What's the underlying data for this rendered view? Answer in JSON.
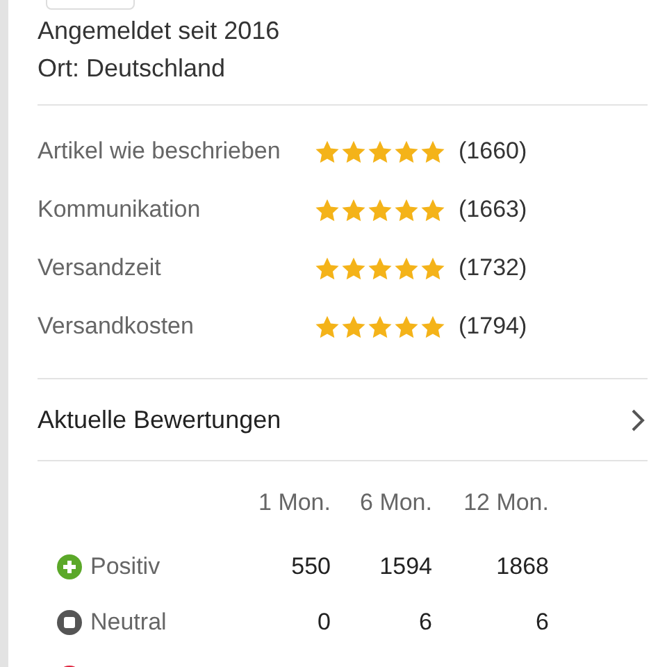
{
  "profile": {
    "member_since": "Angemeldet seit 2016",
    "location": "Ort: Deutschland"
  },
  "ratings": [
    {
      "label": "Artikel wie beschrieben",
      "stars": 5,
      "count": "(1660)"
    },
    {
      "label": "Kommunikation",
      "stars": 5,
      "count": "(1663)"
    },
    {
      "label": "Versandzeit",
      "stars": 5,
      "count": "(1732)"
    },
    {
      "label": "Versandkosten",
      "stars": 5,
      "count": "(1794)"
    }
  ],
  "recent_link": {
    "label": "Aktuelle Bewertungen"
  },
  "feedback_table": {
    "columns": [
      "1 Mon.",
      "6 Mon.",
      "12 Mon."
    ],
    "rows": [
      {
        "kind": "positive",
        "label": "Positiv",
        "values": [
          "550",
          "1594",
          "1868"
        ]
      },
      {
        "kind": "neutral",
        "label": "Neutral",
        "values": [
          "0",
          "6",
          "6"
        ]
      },
      {
        "kind": "negative"
      }
    ]
  }
}
